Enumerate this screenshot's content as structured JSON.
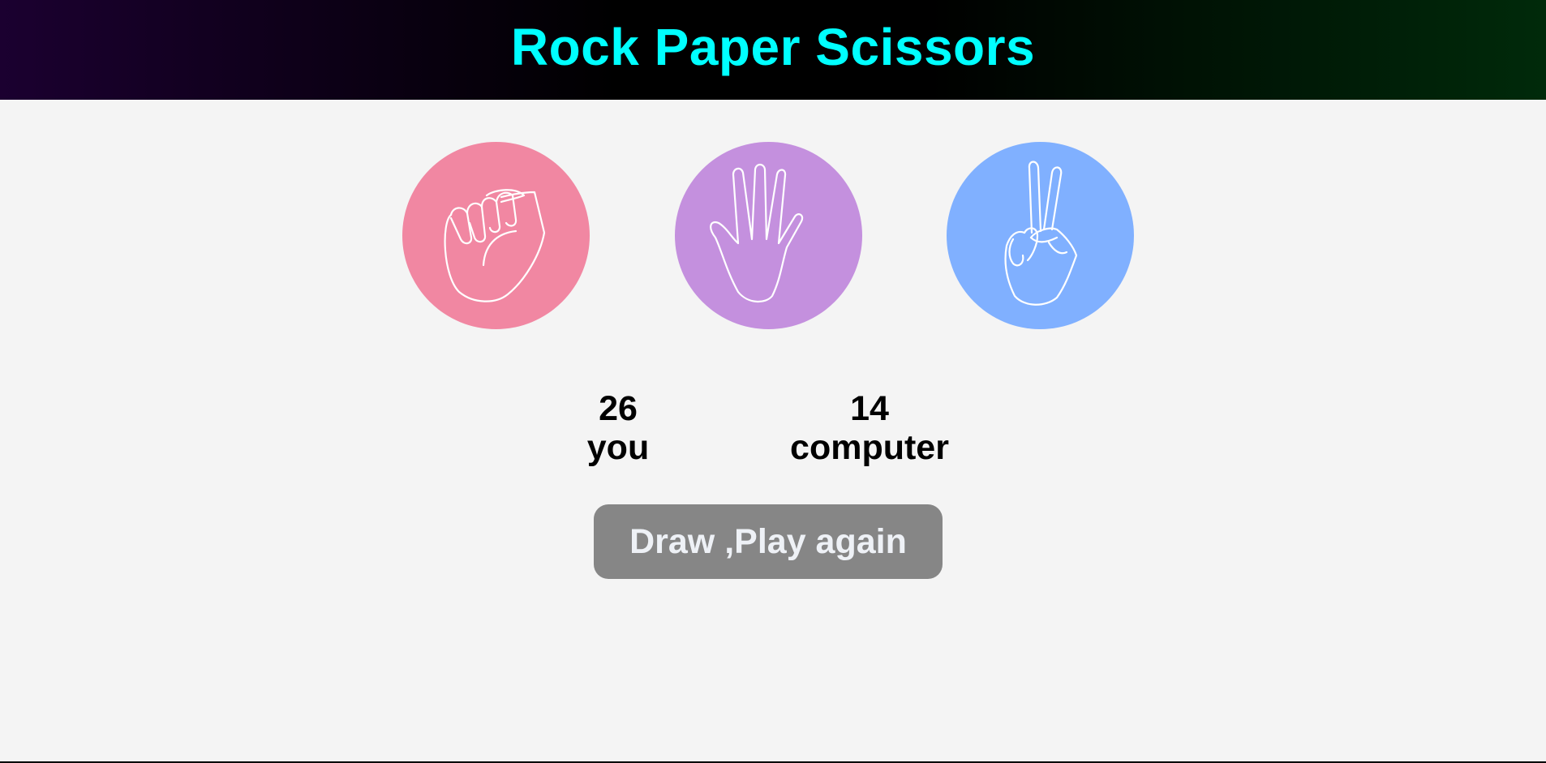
{
  "header": {
    "title": "Rock Paper Scissors"
  },
  "choices": [
    {
      "name": "rock",
      "icon": "fist-icon",
      "color": "#f187a2"
    },
    {
      "name": "paper",
      "icon": "open-hand-icon",
      "color": "#c490de"
    },
    {
      "name": "scissors",
      "icon": "victory-hand-icon",
      "color": "#80b0ff"
    }
  ],
  "scoreboard": {
    "user_score": "26",
    "user_label": "you",
    "computer_score": "14",
    "computer_label": "computer"
  },
  "message": {
    "text": "Draw ,Play again",
    "background": "#868686",
    "text_color": "#eef1f6"
  },
  "theme": {
    "title_color": "#00ffff",
    "page_background": "#f4f4f4"
  }
}
